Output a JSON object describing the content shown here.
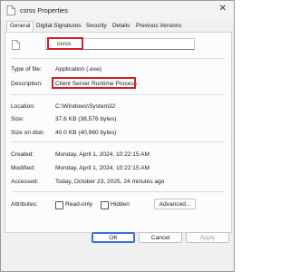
{
  "window": {
    "title": "csrss Properties"
  },
  "tabs": [
    "General",
    "Digital Signatures",
    "Security",
    "Details",
    "Previous Versions"
  ],
  "file": {
    "name": "csrss"
  },
  "fields": {
    "type_label": "Type of file:",
    "type_value": "Application (.exe)",
    "desc_label": "Description:",
    "desc_value": "Client Server Runtime Process",
    "location_label": "Location:",
    "location_value": "C:\\Windows\\System32",
    "size_label": "Size:",
    "size_value": "37.6 KB (38,576 bytes)",
    "disk_label": "Size on disk:",
    "disk_value": "40.0 KB (40,960 bytes)",
    "created_label": "Created:",
    "created_value": "Monday, April 1, 2024, 10:22:15 AM",
    "modified_label": "Modified:",
    "modified_value": "Monday, April 1, 2024, 10:22:15 AM",
    "accessed_label": "Accessed:",
    "accessed_value": "Today, October 23, 2025, 24 minutes ago",
    "attributes_label": "Attributes:"
  },
  "attributes": {
    "readonly": "Read-only",
    "hidden": "Hidden",
    "advanced": "Advanced..."
  },
  "buttons": {
    "ok": "OK",
    "cancel": "Cancel",
    "apply": "Apply"
  },
  "colors": {
    "highlight": "#d21f26",
    "accent": "#3a6fd3"
  }
}
